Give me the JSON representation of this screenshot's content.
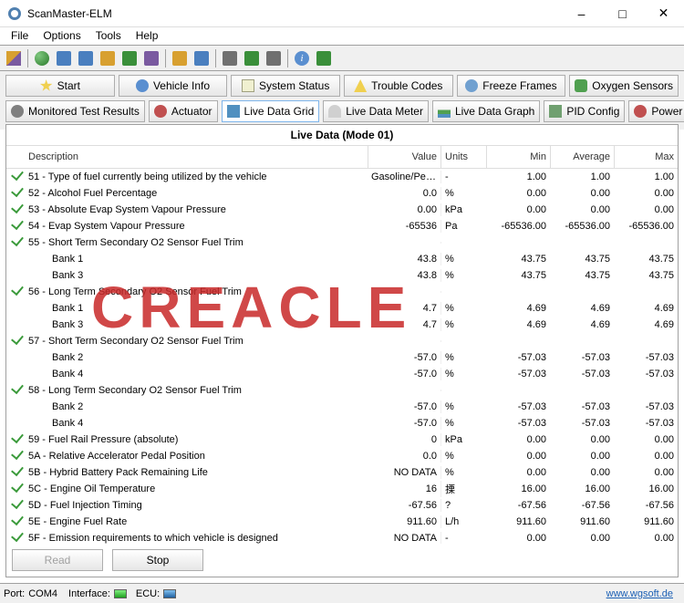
{
  "window": {
    "title": "ScanMaster-ELM"
  },
  "menu": {
    "items": [
      "File",
      "Options",
      "Tools",
      "Help"
    ]
  },
  "nav1": [
    {
      "name": "start",
      "label": "Start",
      "ico": "ni-star"
    },
    {
      "name": "vehicle-info",
      "label": "Vehicle Info",
      "ico": "ni-info"
    },
    {
      "name": "system-status",
      "label": "System Status",
      "ico": "ni-doc"
    },
    {
      "name": "trouble-codes",
      "label": "Trouble Codes",
      "ico": "ni-tri"
    },
    {
      "name": "freeze-frames",
      "label": "Freeze Frames",
      "ico": "ni-snow"
    },
    {
      "name": "oxygen-sensors",
      "label": "Oxygen Sensors",
      "ico": "ni-grn"
    }
  ],
  "nav2": [
    {
      "name": "monitored-test-results",
      "label": "Monitored Test Results",
      "ico": "ni-gear"
    },
    {
      "name": "actuator",
      "label": "Actuator",
      "ico": "ni-red"
    },
    {
      "name": "live-data-grid",
      "label": "Live Data Grid",
      "ico": "ni-grid",
      "active": true
    },
    {
      "name": "live-data-meter",
      "label": "Live Data Meter",
      "ico": "ni-meter"
    },
    {
      "name": "live-data-graph",
      "label": "Live Data Graph",
      "ico": "ni-graph"
    },
    {
      "name": "pid-config",
      "label": "PID Config",
      "ico": "ni-pid"
    },
    {
      "name": "power",
      "label": "Power",
      "ico": "ni-power"
    }
  ],
  "panel": {
    "title": "Live Data (Mode 01)"
  },
  "headers": {
    "desc": "Description",
    "val": "Value",
    "units": "Units",
    "min": "Min",
    "avg": "Average",
    "max": "Max"
  },
  "rows": [
    {
      "chk": 1,
      "desc": "51 - Type of fuel currently being utilized by the vehicle",
      "val": "Gasoline/Petrol",
      "unit": "-",
      "min": "1.00",
      "avg": "1.00",
      "max": "1.00"
    },
    {
      "chk": 1,
      "desc": "52 - Alcohol Fuel Percentage",
      "val": "0.0",
      "unit": "%",
      "min": "0.00",
      "avg": "0.00",
      "max": "0.00"
    },
    {
      "chk": 1,
      "desc": "53 - Absolute Evap System Vapour Pressure",
      "val": "0.00",
      "unit": "kPa",
      "min": "0.00",
      "avg": "0.00",
      "max": "0.00"
    },
    {
      "chk": 1,
      "desc": "54 - Evap System Vapour Pressure",
      "val": "-65536",
      "unit": "Pa",
      "min": "-65536.00",
      "avg": "-65536.00",
      "max": "-65536.00"
    },
    {
      "chk": 1,
      "desc": "55 - Short Term Secondary O2 Sensor Fuel Trim",
      "val": "",
      "unit": "",
      "min": "",
      "avg": "",
      "max": ""
    },
    {
      "chk": 0,
      "desc": "Bank 1",
      "indent": 1,
      "val": "43.8",
      "unit": "%",
      "min": "43.75",
      "avg": "43.75",
      "max": "43.75"
    },
    {
      "chk": 0,
      "desc": "Bank 3",
      "indent": 1,
      "val": "43.8",
      "unit": "%",
      "min": "43.75",
      "avg": "43.75",
      "max": "43.75"
    },
    {
      "chk": 1,
      "desc": "56 - Long Term Secondary O2 Sensor Fuel Trim",
      "val": "",
      "unit": "",
      "min": "",
      "avg": "",
      "max": ""
    },
    {
      "chk": 0,
      "desc": "Bank 1",
      "indent": 1,
      "val": "4.7",
      "unit": "%",
      "min": "4.69",
      "avg": "4.69",
      "max": "4.69"
    },
    {
      "chk": 0,
      "desc": "Bank 3",
      "indent": 1,
      "val": "4.7",
      "unit": "%",
      "min": "4.69",
      "avg": "4.69",
      "max": "4.69"
    },
    {
      "chk": 1,
      "desc": "57 - Short Term Secondary O2 Sensor Fuel Trim",
      "val": "",
      "unit": "",
      "min": "",
      "avg": "",
      "max": ""
    },
    {
      "chk": 0,
      "desc": "Bank 2",
      "indent": 1,
      "val": "-57.0",
      "unit": "%",
      "min": "-57.03",
      "avg": "-57.03",
      "max": "-57.03"
    },
    {
      "chk": 0,
      "desc": "Bank 4",
      "indent": 1,
      "val": "-57.0",
      "unit": "%",
      "min": "-57.03",
      "avg": "-57.03",
      "max": "-57.03"
    },
    {
      "chk": 1,
      "desc": "58 - Long Term Secondary O2 Sensor Fuel Trim",
      "val": "",
      "unit": "",
      "min": "",
      "avg": "",
      "max": ""
    },
    {
      "chk": 0,
      "desc": "Bank 2",
      "indent": 1,
      "val": "-57.0",
      "unit": "%",
      "min": "-57.03",
      "avg": "-57.03",
      "max": "-57.03"
    },
    {
      "chk": 0,
      "desc": "Bank 4",
      "indent": 1,
      "val": "-57.0",
      "unit": "%",
      "min": "-57.03",
      "avg": "-57.03",
      "max": "-57.03"
    },
    {
      "chk": 1,
      "desc": "59 - Fuel Rail Pressure (absolute)",
      "val": "0",
      "unit": "kPa",
      "min": "0.00",
      "avg": "0.00",
      "max": "0.00"
    },
    {
      "chk": 1,
      "desc": "5A - Relative Accelerator Pedal Position",
      "val": "0.0",
      "unit": "%",
      "min": "0.00",
      "avg": "0.00",
      "max": "0.00"
    },
    {
      "chk": 1,
      "desc": "5B - Hybrid Battery Pack Remaining Life",
      "val": "NO DATA",
      "unit": "%",
      "min": "0.00",
      "avg": "0.00",
      "max": "0.00"
    },
    {
      "chk": 1,
      "desc": "5C - Engine Oil Temperature",
      "val": "16",
      "unit": "搮",
      "min": "16.00",
      "avg": "16.00",
      "max": "16.00"
    },
    {
      "chk": 1,
      "desc": "5D - Fuel Injection Timing",
      "val": "-67.56",
      "unit": "?",
      "min": "-67.56",
      "avg": "-67.56",
      "max": "-67.56"
    },
    {
      "chk": 1,
      "desc": "5E - Engine Fuel Rate",
      "val": "911.60",
      "unit": "L/h",
      "min": "911.60",
      "avg": "911.60",
      "max": "911.60"
    },
    {
      "chk": 1,
      "desc": "5F - Emission requirements to which vehicle is designed",
      "val": "NO DATA",
      "unit": "-",
      "min": "0.00",
      "avg": "0.00",
      "max": "0.00"
    }
  ],
  "buttons": {
    "read": "Read",
    "stop": "Stop"
  },
  "status": {
    "port_lbl": "Port:",
    "port_val": "COM4",
    "iface_lbl": "Interface:",
    "ecu_lbl": "ECU:",
    "link": "www.wgsoft.de"
  },
  "watermark": "CREACLE"
}
